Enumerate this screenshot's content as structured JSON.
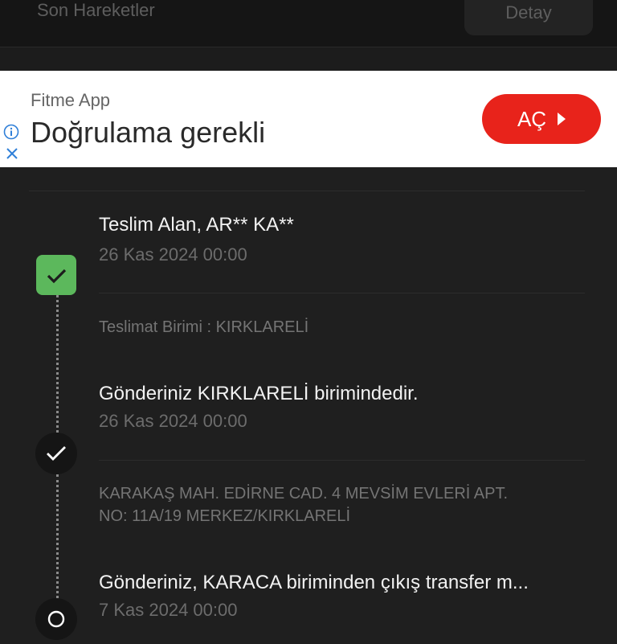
{
  "header": {
    "title": "Son Hareketler",
    "detail_button": "Detay"
  },
  "ad": {
    "brand": "Fitme App",
    "headline": "Doğrulama gerekli",
    "cta": "AÇ",
    "info_icon": "info-icon",
    "close_icon": "close-icon"
  },
  "events": [
    {
      "title": "Teslim Alan, AR** KA**",
      "date": "26 Kas 2024 00:00",
      "note": "Teslimat Birimi : KIRKLARELİ",
      "status_color": "#5cb85c"
    },
    {
      "title": "Gönderiniz KIRKLARELİ birimindedir.",
      "date": "26 Kas 2024 00:00",
      "note_line1": "KARAKAŞ MAH. EDİRNE CAD. 4 MEVSİM EVLERİ APT.",
      "note_line2": "NO: 11A/19 MERKEZ/KIRKLARELİ"
    },
    {
      "title": "Gönderiniz, KARACA biriminden çıkış transfer m...",
      "date": "7 Kas 2024 00:00"
    }
  ]
}
